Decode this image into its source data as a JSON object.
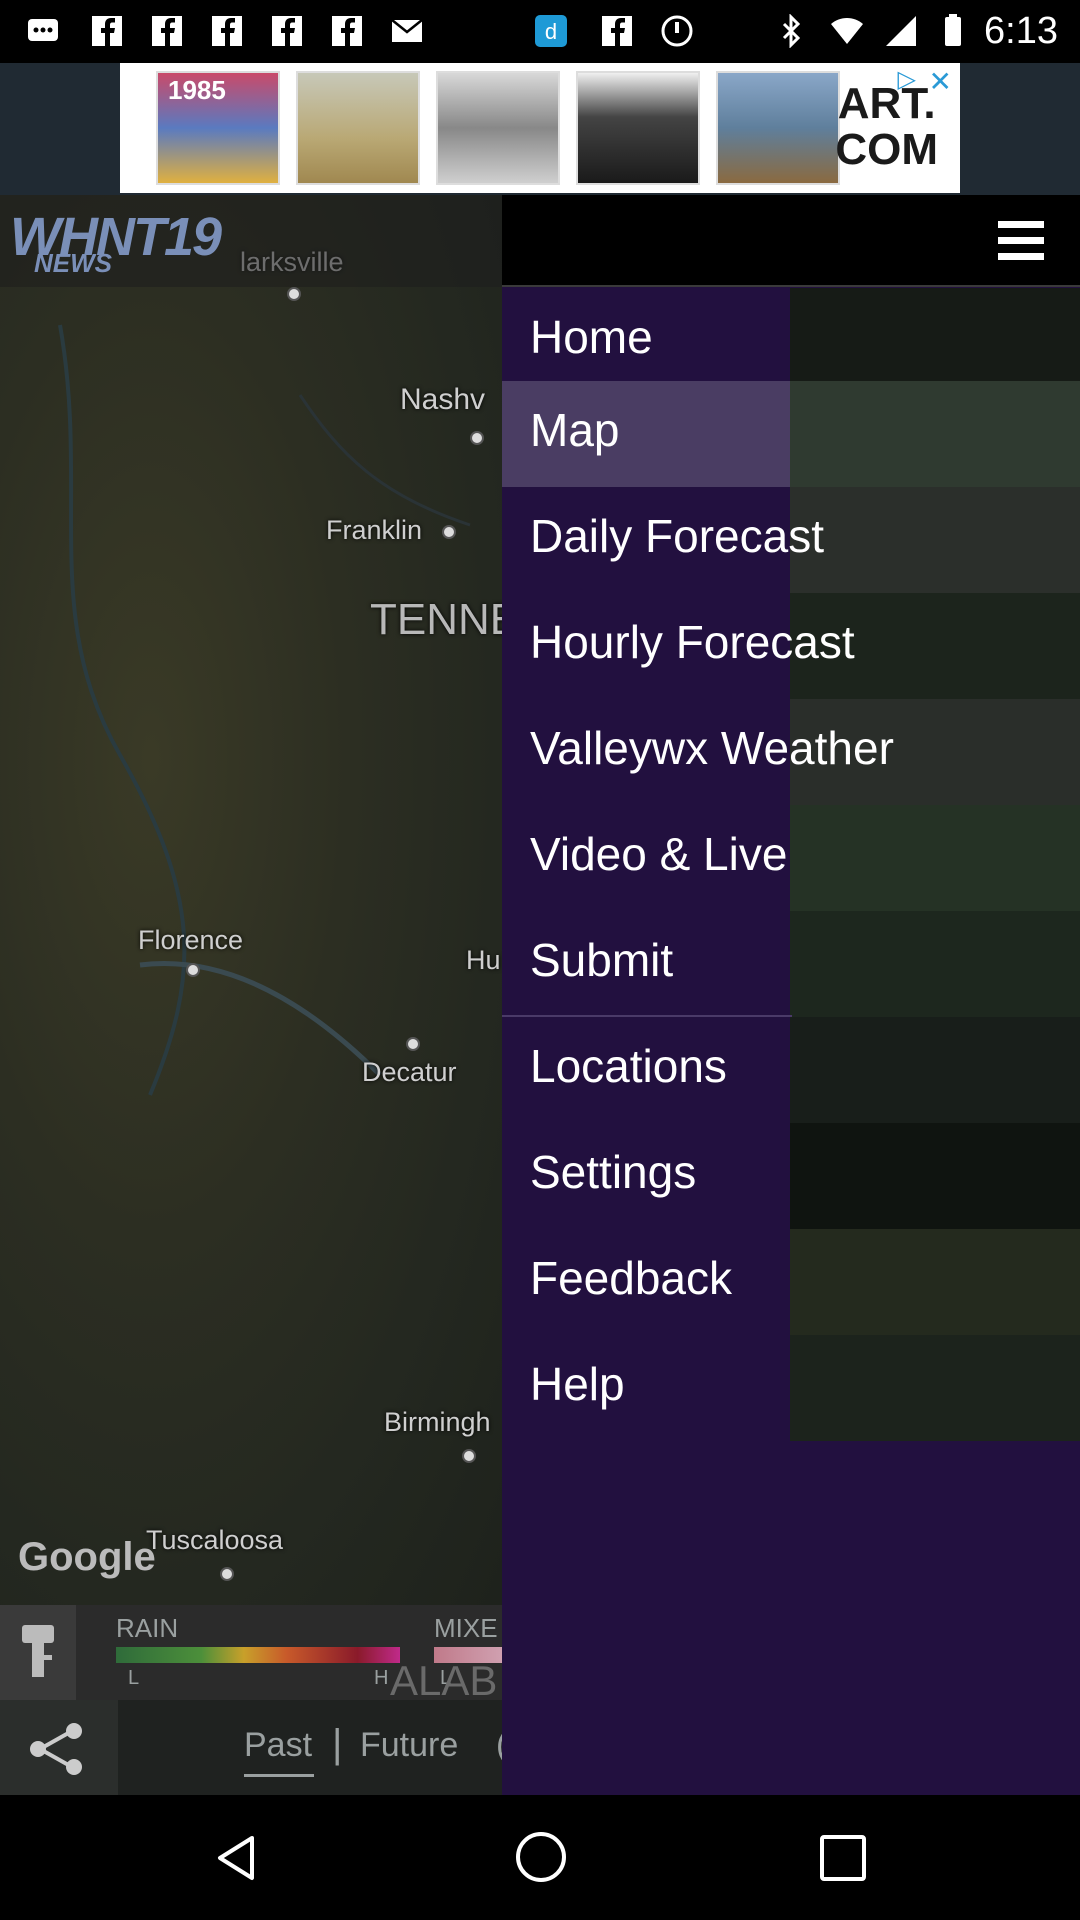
{
  "status_bar": {
    "time": "6:13",
    "icons": [
      "chat-icon",
      "facebook-icon",
      "facebook-icon",
      "facebook-icon",
      "mail-icon",
      "dictionary-icon",
      "facebook-icon",
      "alarm-icon",
      "bluetooth-icon",
      "wifi-icon",
      "signal-icon",
      "battery-icon"
    ]
  },
  "ad": {
    "logo_line1": "ART.",
    "logo_line2": "COM",
    "thumb1_text": "1985"
  },
  "app": {
    "logo_text": "WHNT19",
    "logo_sub": "NEWS"
  },
  "map": {
    "labels": {
      "clarksville": "larksville",
      "nashville": "Nashv",
      "franklin": "Franklin",
      "tennessee": "TENNE",
      "florence": "Florence",
      "huntsville": "Hu",
      "decatur": "Decatur",
      "birmingham": "Birmingh",
      "tuscaloosa": "Tuscaloosa",
      "alabama": "ALAB"
    },
    "google": "Google"
  },
  "legend": {
    "rain": "RAIN",
    "mixed": "MIXE",
    "low": "L",
    "high": "H",
    "low2": "L"
  },
  "timeline": {
    "past": "Past",
    "divider": "|",
    "future": "Future",
    "clipped": "("
  },
  "menu": {
    "items": [
      {
        "label": "Home",
        "selected": false
      },
      {
        "label": "Map",
        "selected": true
      },
      {
        "label": "Daily Forecast",
        "selected": false
      },
      {
        "label": "Hourly Forecast",
        "selected": false
      },
      {
        "label": "Valleywx Weather",
        "selected": false
      },
      {
        "label": "Video & Live",
        "selected": false
      },
      {
        "label": "Submit",
        "selected": false
      },
      {
        "label": "Locations",
        "selected": false
      },
      {
        "label": "Settings",
        "selected": false
      },
      {
        "label": "Feedback",
        "selected": false
      },
      {
        "label": "Help",
        "selected": false
      }
    ]
  },
  "colors": {
    "menu_bg": "#22103f",
    "menu_selected": "#4a3d63"
  }
}
